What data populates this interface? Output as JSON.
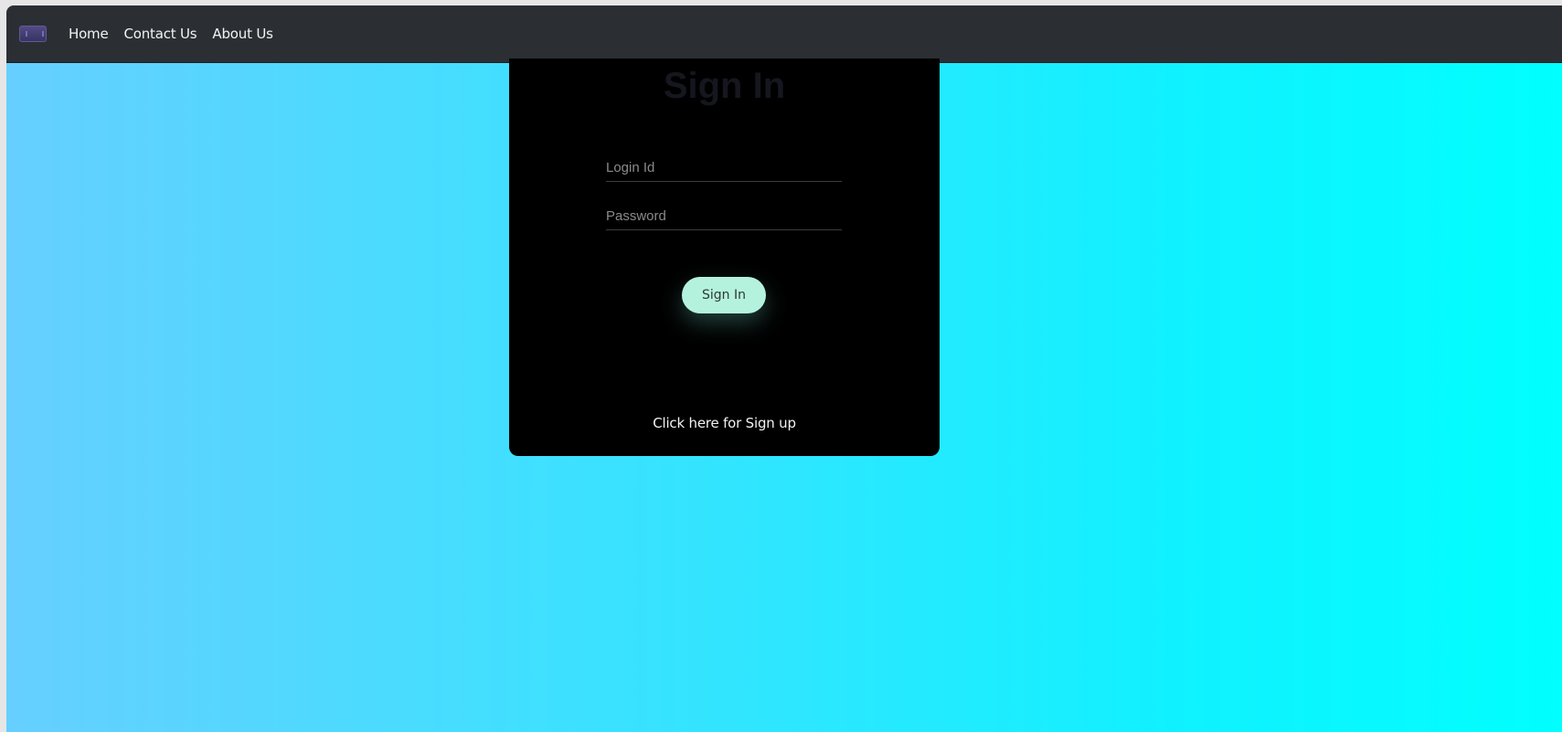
{
  "navbar": {
    "links": [
      "Home",
      "Contact Us",
      "About Us"
    ]
  },
  "signin": {
    "title": "Sign In",
    "login_placeholder": "Login Id",
    "password_placeholder": "Password",
    "button_label": "Sign In",
    "signup_link": "Click here for Sign up"
  },
  "colors": {
    "navbar_bg": "#2b2f33",
    "card_bg": "#000000",
    "button_bg": "#b5f2de",
    "gradient_start": "#66cfff",
    "gradient_end": "#00ffff"
  }
}
